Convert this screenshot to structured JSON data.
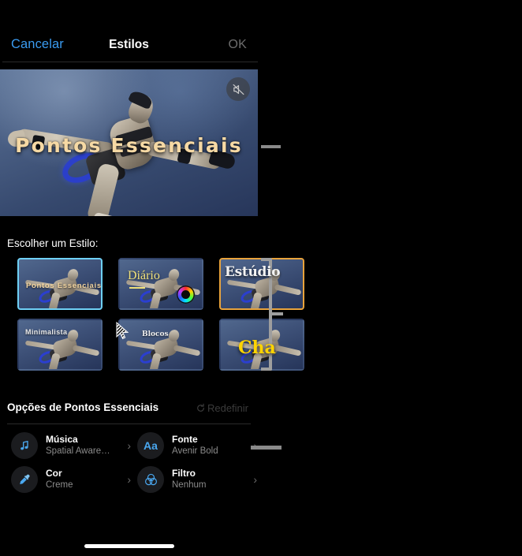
{
  "nav": {
    "cancel_label": "Cancelar",
    "title": "Estilos",
    "ok_label": "OK",
    "cancel_color": "#3a9bf0",
    "ok_color": "#6d6d6d"
  },
  "preview": {
    "title_text": "Pontos Essenciais",
    "title_color": "#f6d9a4",
    "mute_icon": "speaker-muted-icon",
    "muted": true
  },
  "styles": {
    "section_label": "Escolher um Estilo:",
    "selected_border_color": "#6fd0f5",
    "hover_border_color": "#e8a33c",
    "items": [
      {
        "name": "Pontos Essenciais",
        "state": "selected"
      },
      {
        "name": "Diário",
        "state": "normal"
      },
      {
        "name": "Estúdio",
        "state": "hover"
      },
      {
        "name": "Minimalista",
        "state": "normal"
      },
      {
        "name": "Blocos",
        "state": "normal"
      },
      {
        "name": "Chamativo",
        "label_visible": "Cha",
        "state": "normal"
      }
    ]
  },
  "options": {
    "title": "Opções de Pontos Essenciais",
    "reset_label": "Redefinir",
    "reset_icon": "refresh-icon",
    "items": [
      {
        "label": "Música",
        "value": "Spatial Aware…",
        "icon": "music-note-icon",
        "chevron": "›"
      },
      {
        "label": "Fonte",
        "value": "Avenir Bold",
        "icon": "text-aa-icon",
        "chevron": "›"
      },
      {
        "label": "Cor",
        "value": "Creme",
        "icon": "eyedropper-icon",
        "chevron": "›"
      },
      {
        "label": "Filtro",
        "value": "Nenhum",
        "icon": "filter-circles-icon",
        "chevron": "›"
      }
    ]
  },
  "overlay": {
    "bracket_color": "#9e9e9e",
    "rule_color": "#8a8a8a",
    "cursor_icon": "mouse-pointer-icon"
  },
  "system": {
    "home_indicator": "home-indicator"
  }
}
